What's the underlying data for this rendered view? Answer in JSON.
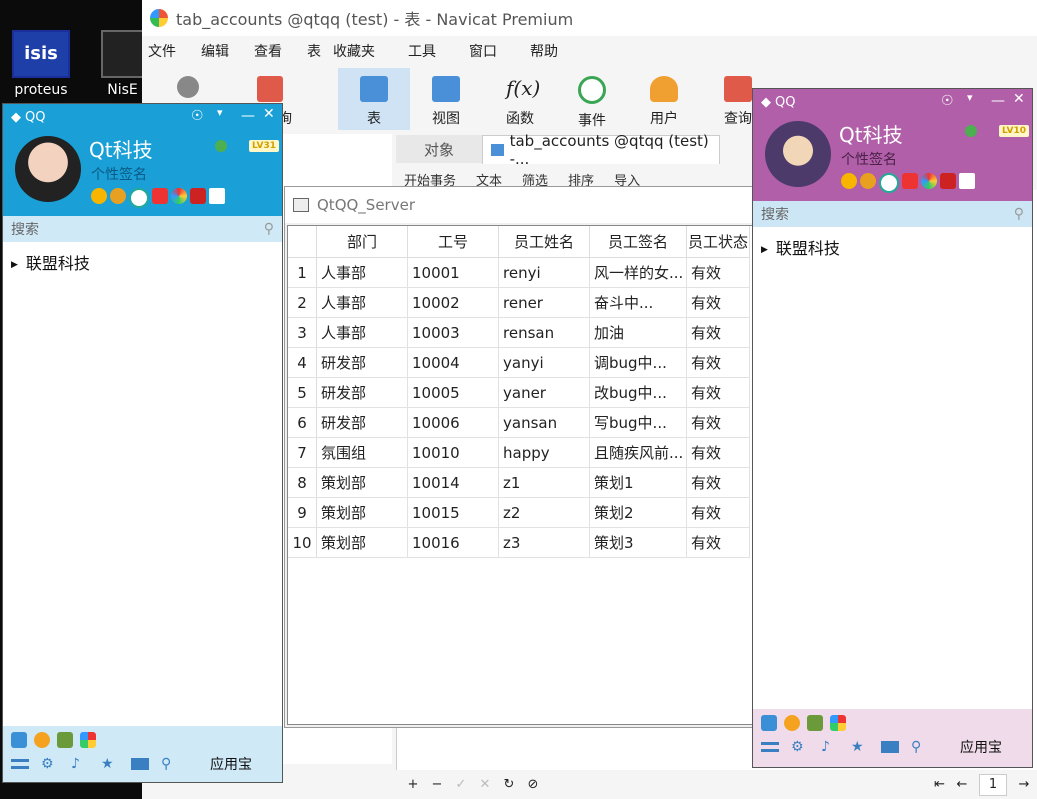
{
  "desktop": {
    "icons": [
      {
        "label": "proteus"
      },
      {
        "label": "NisE"
      }
    ]
  },
  "navicat": {
    "title": "tab_accounts @qtqq (test) - 表 - Navicat Premium",
    "menu": [
      "文件",
      "编辑",
      "查看",
      "表",
      "收藏夹",
      "工具",
      "窗口",
      "帮助"
    ],
    "toolbar": [
      {
        "label": "",
        "icon": "connection-icon"
      },
      {
        "label": "询",
        "icon": "query-icon"
      },
      {
        "label": "表",
        "icon": "table-icon",
        "active": true
      },
      {
        "label": "视图",
        "icon": "view-icon"
      },
      {
        "label": "函数",
        "icon": "function-icon"
      },
      {
        "label": "事件",
        "icon": "event-icon"
      },
      {
        "label": "用户",
        "icon": "user-icon"
      },
      {
        "label": "查询",
        "icon": "query-icon"
      }
    ],
    "tab_objects": "对象",
    "tab_table": "tab_accounts @qtqq (test) -...",
    "subtoolbar": [
      "开始事务",
      "文本",
      "筛选",
      "排序",
      "导入"
    ],
    "bottombar": [
      "+",
      "−",
      "✓",
      "✕",
      "↻",
      "⊘"
    ],
    "page_number": "1"
  },
  "server": {
    "title": "QtQQ_Server",
    "columns": [
      "部门",
      "工号",
      "员工姓名",
      "员工签名",
      "员工状态"
    ],
    "rows": [
      [
        "1",
        "人事部",
        "10001",
        "renyi",
        "风一样的女...",
        "有效"
      ],
      [
        "2",
        "人事部",
        "10002",
        "rener",
        "奋斗中...",
        "有效"
      ],
      [
        "3",
        "人事部",
        "10003",
        "rensan",
        "加油",
        "有效"
      ],
      [
        "4",
        "研发部",
        "10004",
        "yanyi",
        "调bug中...",
        "有效"
      ],
      [
        "5",
        "研发部",
        "10005",
        "yaner",
        "改bug中...",
        "有效"
      ],
      [
        "6",
        "研发部",
        "10006",
        "yansan",
        "写bug中...",
        "有效"
      ],
      [
        "7",
        "氛围组",
        "10010",
        "happy",
        "且随疾风前...",
        "有效"
      ],
      [
        "8",
        "策划部",
        "10014",
        "z1",
        "策划1",
        "有效"
      ],
      [
        "9",
        "策划部",
        "10015",
        "z2",
        "策划2",
        "有效"
      ],
      [
        "10",
        "策划部",
        "10016",
        "z3",
        "策划3",
        "有效"
      ]
    ]
  },
  "qq_left": {
    "app": "QQ",
    "name": "Qt科技",
    "signature": "个性签名",
    "level": "LV31",
    "search_placeholder": "搜索",
    "group": "联盟科技",
    "appstore": "应用宝",
    "color": "#1aa0d6"
  },
  "qq_right": {
    "app": "QQ",
    "name": "Qt科技",
    "signature": "个性签名",
    "level": "LV10",
    "search_placeholder": "搜索",
    "group": "联盟科技",
    "appstore": "应用宝",
    "color": "#b05fa8"
  }
}
